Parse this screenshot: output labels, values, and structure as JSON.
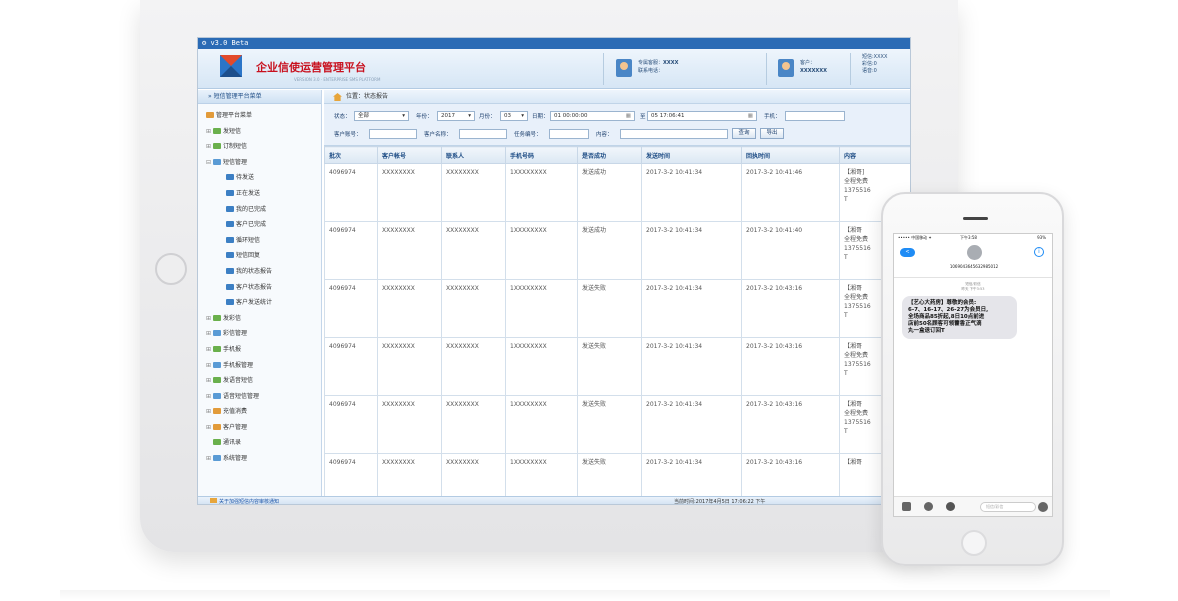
{
  "window": {
    "title": "v3.0 Beta"
  },
  "header": {
    "brand": "企业信使运营管理平台",
    "brand_sub": "VERSION 3.0 · ENTERPRISE SMS PLATFORM",
    "service_label": "专属客服：",
    "service_value": "XXXX",
    "contact_label": "联系电话：",
    "client_label": "客户：",
    "client_value": "XXXXXXX",
    "balance_sms": "短信:XXXX",
    "balance_mms": "彩信:0",
    "balance_voice": "语音:0"
  },
  "sidebar": {
    "title": "» 短信管理平台菜单",
    "root": "管理平台菜单",
    "items": [
      {
        "label": "发短信",
        "pm": "⊞",
        "icon": "g",
        "sub": false
      },
      {
        "label": "订制短信",
        "pm": "⊞",
        "icon": "g",
        "sub": false
      },
      {
        "label": "短信管理",
        "pm": "⊟",
        "icon": "b",
        "sub": false
      },
      {
        "label": "待发送",
        "pm": "",
        "icon": "s",
        "sub": true
      },
      {
        "label": "正在发送",
        "pm": "",
        "icon": "s",
        "sub": true
      },
      {
        "label": "我的已完成",
        "pm": "",
        "icon": "s",
        "sub": true
      },
      {
        "label": "客户已完成",
        "pm": "",
        "icon": "s",
        "sub": true
      },
      {
        "label": "循环短信",
        "pm": "",
        "icon": "s",
        "sub": true
      },
      {
        "label": "短信回复",
        "pm": "",
        "icon": "s",
        "sub": true
      },
      {
        "label": "我的状态报告",
        "pm": "",
        "icon": "s",
        "sub": true
      },
      {
        "label": "客户状态报告",
        "pm": "",
        "icon": "s",
        "sub": true
      },
      {
        "label": "客户发送统计",
        "pm": "",
        "icon": "s",
        "sub": true
      },
      {
        "label": "发彩信",
        "pm": "⊞",
        "icon": "g",
        "sub": false
      },
      {
        "label": "彩信管理",
        "pm": "⊞",
        "icon": "b",
        "sub": false
      },
      {
        "label": "手机报",
        "pm": "⊞",
        "icon": "g",
        "sub": false
      },
      {
        "label": "手机报管理",
        "pm": "⊞",
        "icon": "b",
        "sub": false
      },
      {
        "label": "发语音短信",
        "pm": "⊞",
        "icon": "g",
        "sub": false
      },
      {
        "label": "语音短信管理",
        "pm": "⊞",
        "icon": "b",
        "sub": false
      },
      {
        "label": "充值消费",
        "pm": "⊞",
        "icon": "h",
        "sub": false
      },
      {
        "label": "客户管理",
        "pm": "⊞",
        "icon": "h",
        "sub": false
      },
      {
        "label": "通讯录",
        "pm": "",
        "icon": "g",
        "sub": false
      },
      {
        "label": "系统管理",
        "pm": "⊞",
        "icon": "b",
        "sub": false
      }
    ]
  },
  "breadcrumb": "位置：状态报告",
  "filters": {
    "status_label": "状态：",
    "status_value": "全部",
    "year_label": "年份：",
    "year_value": "2017",
    "month_label": "月份：",
    "month_value": "03",
    "date_label": "日期：",
    "date_from": "01 00:00:00",
    "date_to_label": "至",
    "date_to": "05 17:06:41",
    "mobile_label": "手机：",
    "account_label": "客户账号：",
    "name_label": "客户名称：",
    "task_label": "任务编号：",
    "content_label": "内容：",
    "search_btn": "查询",
    "export_btn": "导出"
  },
  "table": {
    "headers": [
      "批次",
      "客户帐号",
      "联系人",
      "手机号码",
      "是否成功",
      "发送时间",
      "回执时间",
      "内容"
    ],
    "rows": [
      [
        "4096974",
        "XXXXXXXX",
        "XXXXXXXX",
        "1XXXXXXXX",
        "发送成功",
        "2017-3-2 10:41:34",
        "2017-3-2 10:41:46",
        "【湘哥]\n全程免费\n1375516\nT"
      ],
      [
        "4096974",
        "XXXXXXXX",
        "XXXXXXXX",
        "1XXXXXXXX",
        "发送成功",
        "2017-3-2 10:41:34",
        "2017-3-2 10:41:40",
        "【湘哥\n全程免费\n1375516\nT"
      ],
      [
        "4096974",
        "XXXXXXXX",
        "XXXXXXXX",
        "1XXXXXXXX",
        "发送失败",
        "2017-3-2 10:41:34",
        "2017-3-2 10:43:16",
        "【湘哥\n全程免费\n1375516\nT"
      ],
      [
        "4096974",
        "XXXXXXXX",
        "XXXXXXXX",
        "1XXXXXXXX",
        "发送失败",
        "2017-3-2 10:41:34",
        "2017-3-2 10:43:16",
        "【湘哥\n全程免费\n1375516\nT"
      ],
      [
        "4096974",
        "XXXXXXXX",
        "XXXXXXXX",
        "1XXXXXXXX",
        "发送失败",
        "2017-3-2 10:41:34",
        "2017-3-2 10:43:16",
        "【湘哥\n全程免费\n1375516\nT"
      ],
      [
        "4096974",
        "XXXXXXXX",
        "XXXXXXXX",
        "1XXXXXXXX",
        "发送失败",
        "2017-3-2 10:41:34",
        "2017-3-2 10:43:16",
        "【湘哥"
      ]
    ]
  },
  "status_bar": {
    "link": "关于加强短信内容审核通知",
    "time": "当前时间:2017年4月5日 17:06:22 下午"
  },
  "phone": {
    "carrier": "••••• 中国移动 ✦",
    "clock": "下午3:58",
    "battery": "93%",
    "back": "<",
    "number": "1069043645632985012",
    "info": "i",
    "ts1": "短信/彩信",
    "ts2": "昨天 下午3:53",
    "message": "【艺心大药房】尊敬的会员:\n6-7、16-17、26-27为会员日,\n全场商品85折起,8日10点前进\n店前50名顾客可领藿香正气滴\n丸一盒退订回T",
    "input_placeholder": "短信/彩信"
  },
  "colors": {
    "accent": "#2b6bb5",
    "brand_red": "#c8101e"
  }
}
